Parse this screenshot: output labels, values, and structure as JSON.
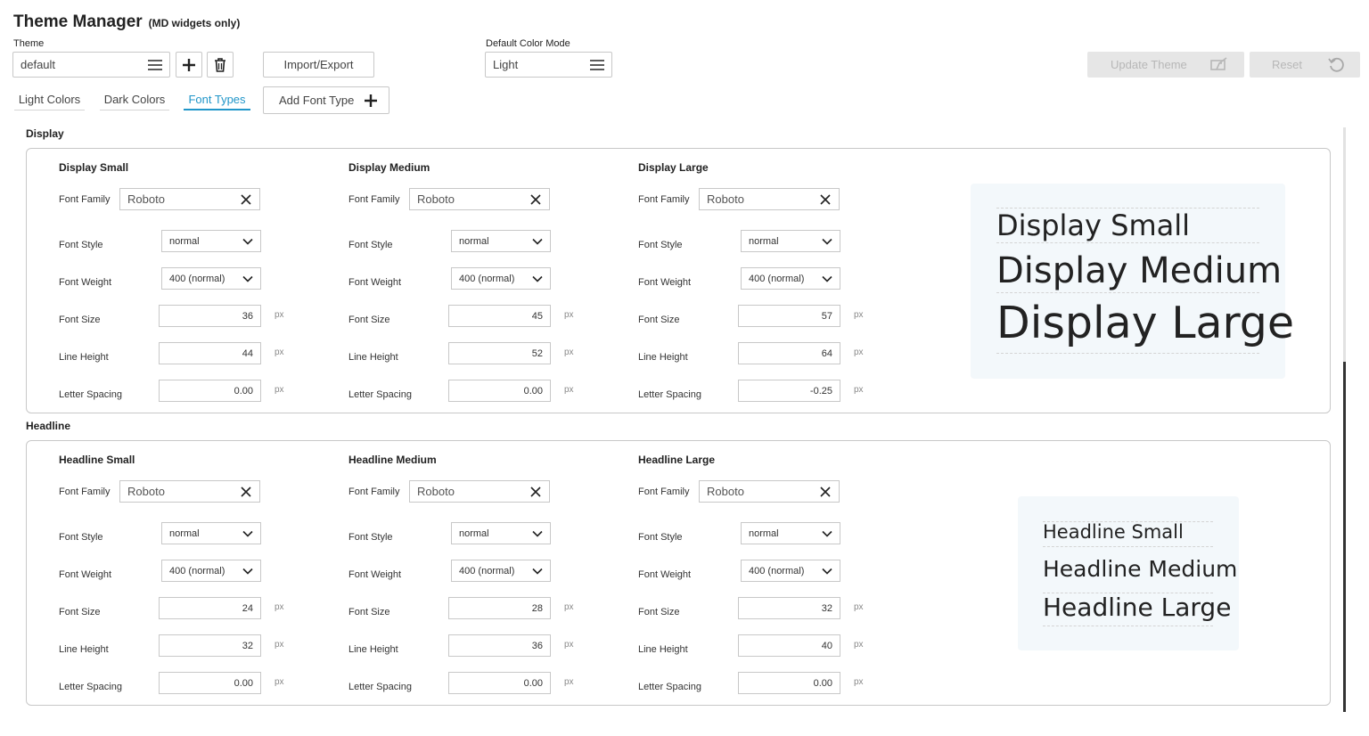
{
  "header": {
    "title": "Theme Manager",
    "subtitle": "(MD widgets only)"
  },
  "theme_select": {
    "label": "Theme",
    "value": "default"
  },
  "icons": {
    "menu": "hamburger-menu-icon",
    "add": "plus-icon",
    "delete": "trash-icon",
    "clear": "close-icon",
    "dropdown": "chevron-down-icon",
    "update": "update-screen-icon",
    "reset": "reset-icon"
  },
  "toolbar": {
    "import_export": "Import/Export",
    "update_theme": "Update Theme",
    "reset": "Reset"
  },
  "color_mode": {
    "label": "Default Color Mode",
    "value": "Light"
  },
  "tabs": [
    {
      "label": "Light Colors",
      "active": false
    },
    {
      "label": "Dark Colors",
      "active": false
    },
    {
      "label": "Font Types",
      "active": true
    }
  ],
  "add_font_type": "Add Font Type",
  "field_labels": {
    "font_family": "Font Family",
    "font_style": "Font Style",
    "font_weight": "Font Weight",
    "font_size": "Font Size",
    "line_height": "Line Height",
    "letter_spacing": "Letter Spacing",
    "unit": "px"
  },
  "sections": [
    {
      "title": "Display",
      "fonts": [
        {
          "name": "Display Small",
          "family": "Roboto",
          "style": "normal",
          "weight": "400 (normal)",
          "size": "36",
          "line_height": "44",
          "letter_spacing": "0.00"
        },
        {
          "name": "Display Medium",
          "family": "Roboto",
          "style": "normal",
          "weight": "400 (normal)",
          "size": "45",
          "line_height": "52",
          "letter_spacing": "0.00"
        },
        {
          "name": "Display Large",
          "family": "Roboto",
          "style": "normal",
          "weight": "400 (normal)",
          "size": "57",
          "line_height": "64",
          "letter_spacing": "-0.25"
        }
      ]
    },
    {
      "title": "Headline",
      "fonts": [
        {
          "name": "Headline Small",
          "family": "Roboto",
          "style": "normal",
          "weight": "400 (normal)",
          "size": "24",
          "line_height": "32",
          "letter_spacing": "0.00"
        },
        {
          "name": "Headline Medium",
          "family": "Roboto",
          "style": "normal",
          "weight": "400 (normal)",
          "size": "28",
          "line_height": "36",
          "letter_spacing": "0.00"
        },
        {
          "name": "Headline Large",
          "family": "Roboto",
          "style": "normal",
          "weight": "400 (normal)",
          "size": "32",
          "line_height": "40",
          "letter_spacing": "0.00"
        }
      ]
    }
  ],
  "colors": {
    "accent": "#2196c9",
    "preview_bg": "#f3f8fb",
    "border": "#c8c8c8"
  }
}
